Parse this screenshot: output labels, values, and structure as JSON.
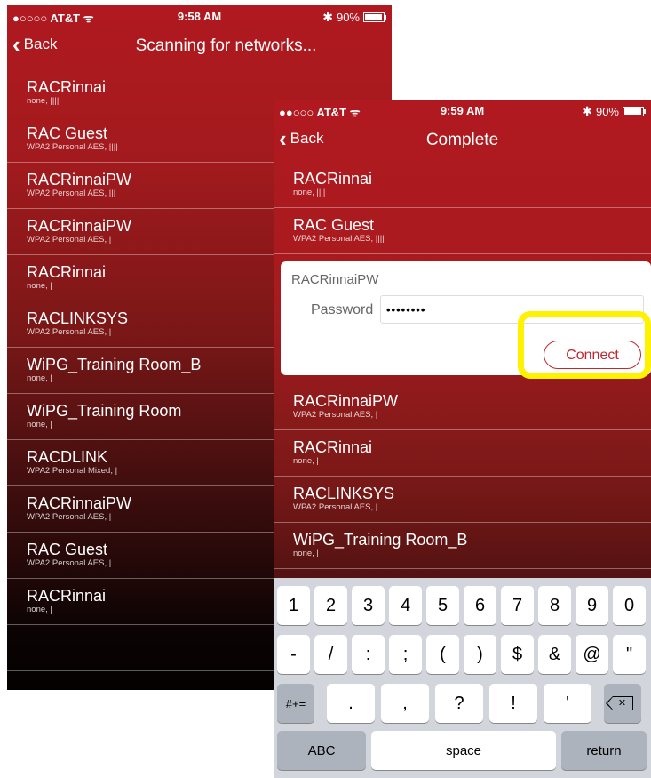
{
  "back_screen": {
    "status": {
      "carrier": "●○○○○ AT&T ᯤ",
      "time": "9:58 AM",
      "battery": "90%"
    },
    "nav": {
      "back_label": "Back",
      "title": "Scanning for networks..."
    },
    "networks": [
      {
        "ssid": "RACRinnai",
        "meta": "none, ||||"
      },
      {
        "ssid": "RAC Guest",
        "meta": "WPA2 Personal AES, ||||"
      },
      {
        "ssid": "RACRinnaiPW",
        "meta": "WPA2 Personal AES, |||"
      },
      {
        "ssid": "RACRinnaiPW",
        "meta": "WPA2 Personal AES, |"
      },
      {
        "ssid": "RACRinnai",
        "meta": "none, |"
      },
      {
        "ssid": "RACLINKSYS",
        "meta": "WPA2 Personal AES, |"
      },
      {
        "ssid": "WiPG_Training Room_B",
        "meta": "none, |"
      },
      {
        "ssid": "WiPG_Training Room",
        "meta": "none, |"
      },
      {
        "ssid": "RACDLINK",
        "meta": "WPA2 Personal Mixed, |"
      },
      {
        "ssid": "RACRinnaiPW",
        "meta": "WPA2 Personal AES, |"
      },
      {
        "ssid": "RAC Guest",
        "meta": "WPA2 Personal AES, |"
      },
      {
        "ssid": "RACRinnai",
        "meta": "none, |"
      }
    ]
  },
  "front_screen": {
    "status": {
      "carrier": "●●○○○ AT&T ᯤ",
      "time": "9:59 AM",
      "battery": "90%"
    },
    "nav": {
      "back_label": "Back",
      "title": "Complete"
    },
    "networks_top": [
      {
        "ssid": "RACRinnai",
        "meta": "none, ||||"
      },
      {
        "ssid": "RAC Guest",
        "meta": "WPA2 Personal AES, ||||"
      }
    ],
    "connect_card": {
      "ssid": "RACRinnaiPW",
      "password_label": "Password",
      "password_value": "••••••••",
      "connect_label": "Connect"
    },
    "networks_bottom": [
      {
        "ssid": "RACRinnaiPW",
        "meta": "WPA2 Personal AES, |"
      },
      {
        "ssid": "RACRinnai",
        "meta": "none, |"
      },
      {
        "ssid": "RACLINKSYS",
        "meta": "WPA2 Personal AES, |"
      },
      {
        "ssid": "WiPG_Training Room_B",
        "meta": "none, |"
      }
    ],
    "keyboard": {
      "row1": [
        "1",
        "2",
        "3",
        "4",
        "5",
        "6",
        "7",
        "8",
        "9",
        "0"
      ],
      "row2": [
        "-",
        "/",
        ":",
        ";",
        "(",
        ")",
        "$",
        "&",
        "@",
        "\""
      ],
      "row3": {
        "mode": "#+=",
        "keys": [
          ".",
          ",",
          "?",
          "!",
          "'"
        ]
      },
      "row4": {
        "abc": "ABC",
        "space": "space",
        "return": "return"
      }
    }
  },
  "colors": {
    "brand_red": "#b0191f",
    "highlight": "#fff200",
    "connect_red": "#c0282e"
  }
}
